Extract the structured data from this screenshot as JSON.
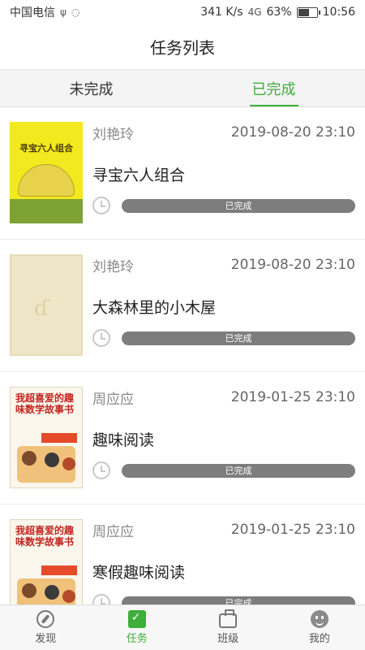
{
  "status_bar": {
    "carrier": "中国电信",
    "speed": "341 K/s",
    "network": "4G",
    "battery": "63%",
    "battery_level": 0.63,
    "time": "10:56"
  },
  "header": {
    "title": "任务列表"
  },
  "tabs": [
    {
      "label": "未完成",
      "active": false
    },
    {
      "label": "已完成",
      "active": true
    }
  ],
  "tasks": [
    {
      "teacher": "刘艳玲",
      "datetime": "2019-08-20 23:10",
      "title": "寻宝六人组合",
      "status": "已完成",
      "cover_text": "寻宝六人组合"
    },
    {
      "teacher": "刘艳玲",
      "datetime": "2019-08-20 23:10",
      "title": "大森林里的小木屋",
      "status": "已完成"
    },
    {
      "teacher": "周应应",
      "datetime": "2019-01-25 23:10",
      "title": "趣味阅读",
      "status": "已完成",
      "cover_text": "我超喜爱的趣味数学故事书"
    },
    {
      "teacher": "周应应",
      "datetime": "2019-01-25 23:10",
      "title": "寒假趣味阅读",
      "status": "已完成",
      "cover_text": "我超喜爱的趣味数学故事书"
    }
  ],
  "bottom_nav": [
    {
      "label": "发现",
      "icon": "compass-icon",
      "active": false
    },
    {
      "label": "任务",
      "icon": "task-icon",
      "active": true
    },
    {
      "label": "班级",
      "icon": "class-icon",
      "active": false
    },
    {
      "label": "我的",
      "icon": "me-icon",
      "active": false
    }
  ],
  "colors": {
    "accent": "#3fae3a",
    "pill": "#7d7d7d"
  }
}
